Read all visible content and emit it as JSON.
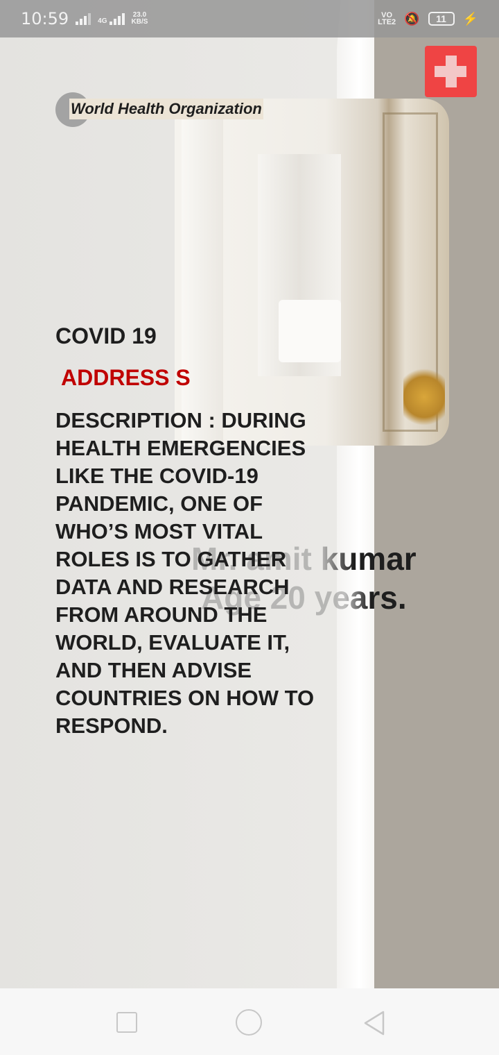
{
  "status_bar": {
    "time": "10:59",
    "network_type": "4G",
    "speed_value": "23.0",
    "speed_unit": "KB/S",
    "volte": "VO",
    "volte_sub": "LTE2",
    "battery": "11"
  },
  "header": {
    "organization": "World Health Organization",
    "cross_icon": "medical-cross-icon",
    "accent_color": "#ef4444"
  },
  "main": {
    "title": "COVID 19",
    "address": "ADDRESS S",
    "description": "DESCRIPTION : DURING HEALTH EMERGENCIES LIKE THE COVID-19 PANDEMIC, ONE OF WHO’S MOST VITAL ROLES IS TO GATHER DATA AND RESEARCH FROM AROUND THE WORLD, EVALUATE IT, AND THEN ADVISE COUNTRIES ON HOW TO RESPOND.",
    "name": "Mr. amit kumar",
    "age": "Age 20 years.",
    "address_color": "#c00000"
  },
  "nav_bar": {
    "recent_icon": "square-recent-apps-icon",
    "home_icon": "circle-home-icon",
    "back_icon": "triangle-back-icon"
  }
}
